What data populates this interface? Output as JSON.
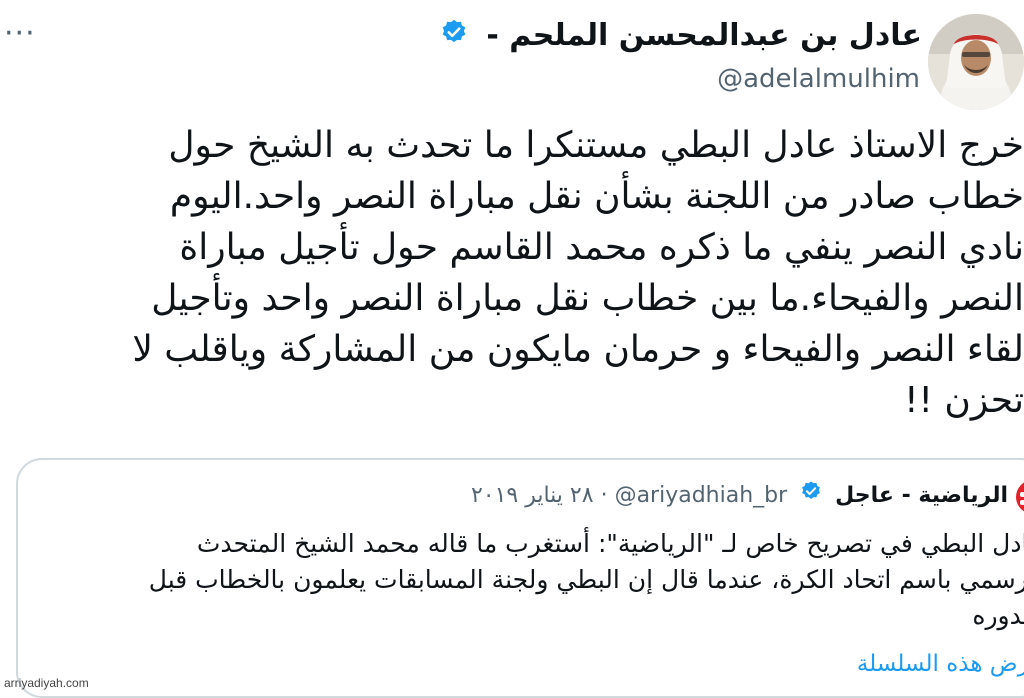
{
  "header": {
    "menu_label": "···",
    "display_name": "عادل بن عبدالمحسن الملحم -",
    "handle": "@adelalmulhim",
    "verified_icon": "verified-badge-icon"
  },
  "tweet": {
    "text_lines": [
      "خرج الاستاذ عادل البطي مستنكرا ما تحدث به الشيخ حول",
      "خطاب صادر من اللجنة بشأن نقل مباراة النصر واحد.اليوم",
      "نادي النصر ينفي ما ذكره محمد القاسم حول تأجيل مباراة",
      "النصر والفيحاء.ما بين خطاب نقل مباراة النصر واحد وتأجيل",
      "لقاء النصر والفيحاء و حرمان مايكون من المشاركة وياقلب لا",
      "تحزن !!"
    ]
  },
  "quote": {
    "name": "الرياضية - عاجل",
    "handle": "@ariyadhiah_br",
    "dot": "·",
    "date": "٢٨ يناير ٢٠١٩",
    "text_lines": [
      "عادل البطي في تصريح خاص لـ \"الرياضية\": أستغرب ما قاله محمد الشيخ المتحدث",
      "الرسمي باسم اتحاد الكرة، عندما قال إن البطي ولجنة المسابقات يعلمون بالخطاب قبل",
      "صدوره"
    ],
    "show_thread": "عرض هذه السلسلة"
  },
  "watermark": "arriyadiyah.com",
  "colors": {
    "accent": "#1d9bf0",
    "text": "#0f1419",
    "muted": "#536471",
    "logo_red": "#e3232c"
  }
}
